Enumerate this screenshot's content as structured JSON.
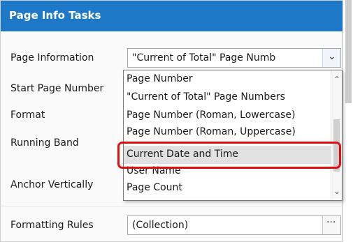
{
  "panel": {
    "title": "Page Info Tasks",
    "fields": {
      "page_information_label": "Page Information",
      "start_page_number_label": "Start Page Number",
      "format_label": "Format",
      "running_band_label": "Running Band",
      "anchor_vertically_label": "Anchor Vertically",
      "formatting_rules_label": "Formatting Rules"
    },
    "page_information_value": "\"Current of Total\" Page Numb",
    "formatting_rules_value": "(Collection)",
    "ellipsis": "···"
  },
  "dropdown": {
    "items": [
      "Page Number",
      "\"Current of Total\" Page Numbers",
      "Page Number (Roman, Lowercase)",
      "Page Number (Roman, Uppercase)",
      "Current Date and Time",
      "User Name",
      "Page Count"
    ],
    "selected_index": 4
  },
  "icons": {
    "dropdown_arrow": "chevron-down-icon",
    "scroll_up": "scroll-up-icon",
    "scroll_down": "scroll-down-icon"
  },
  "colors": {
    "header": "#1e78c8",
    "highlight": "#e01010",
    "selected_item": "#e1e1e1"
  }
}
